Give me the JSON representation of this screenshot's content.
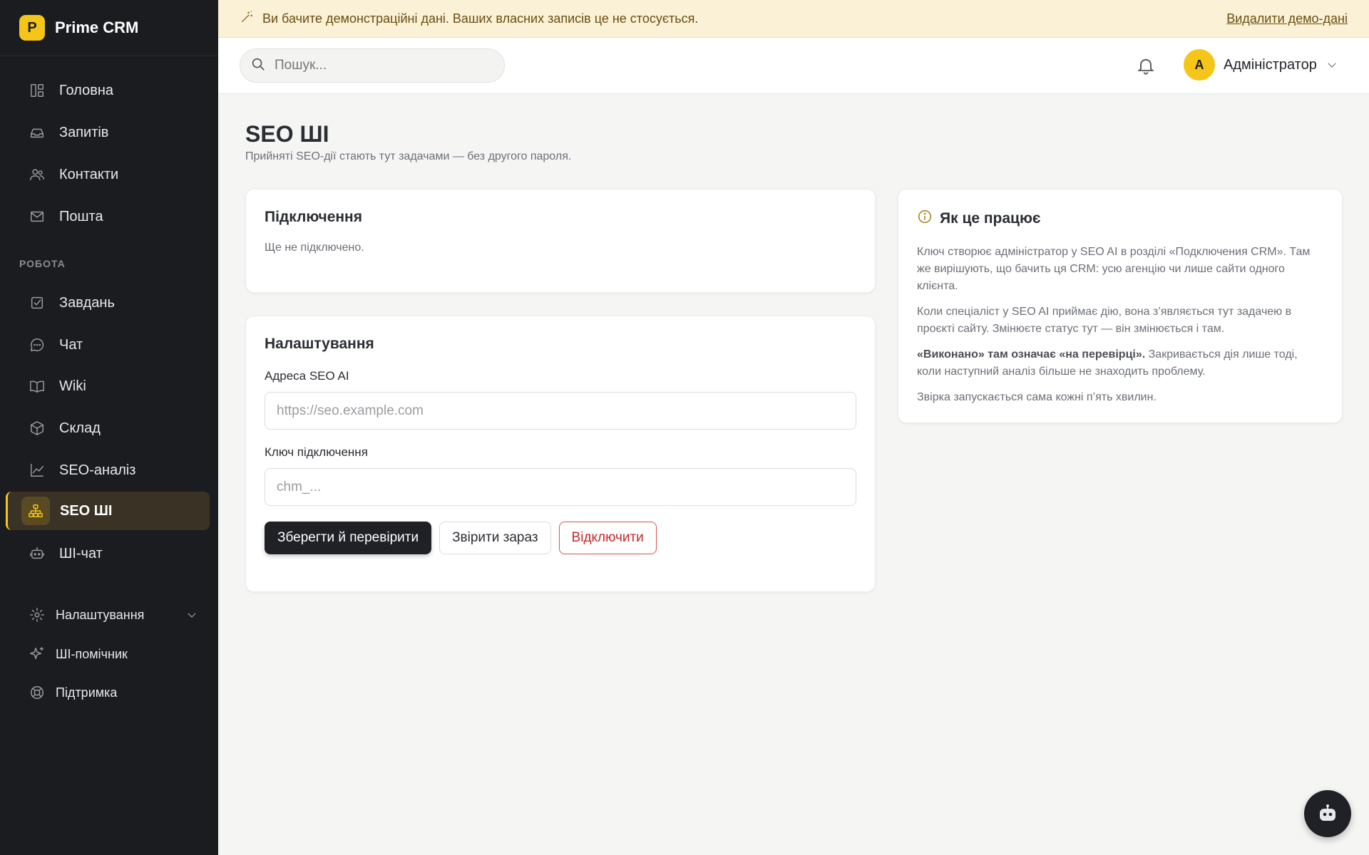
{
  "app": {
    "logo_letter": "P",
    "name": "Prime CRM"
  },
  "banner": {
    "message": "Ви бачите демонстраційні дані. Ваших власних записів це не стосується.",
    "remove_link": "Видалити демо-дані"
  },
  "header": {
    "search_placeholder": "Пошук...",
    "user_initial": "A",
    "user_name": "Адміністратор"
  },
  "sidebar": {
    "main_items": [
      {
        "label": "Головна",
        "icon": "dashboard-icon"
      },
      {
        "label": "Запитів",
        "icon": "inbox-icon"
      },
      {
        "label": "Контакти",
        "icon": "users-icon"
      },
      {
        "label": "Пошта",
        "icon": "mail-icon"
      }
    ],
    "section_label": "РОБОТА",
    "work_items": [
      {
        "label": "Завдань",
        "icon": "checkbox-icon"
      },
      {
        "label": "Чат",
        "icon": "chat-icon"
      },
      {
        "label": "Wiki",
        "icon": "book-icon"
      },
      {
        "label": "Склад",
        "icon": "box-icon"
      },
      {
        "label": "SEO-аналіз",
        "icon": "chart-icon"
      },
      {
        "label": "SEO ШІ",
        "icon": "hierarchy-icon",
        "active": true
      },
      {
        "label": "ШІ-чат",
        "icon": "robot-icon"
      }
    ],
    "bottom_items": [
      {
        "label": "Налаштування",
        "icon": "gear-icon"
      },
      {
        "label": "ШІ-помічник",
        "icon": "sparkle-icon"
      },
      {
        "label": "Підтримка",
        "icon": "lifebuoy-icon"
      }
    ]
  },
  "page": {
    "title": "SEO ШІ",
    "subtitle": "Прийняті SEO-дії стають тут задачами — без другого пароля."
  },
  "connection_card": {
    "title": "Підключення",
    "status": "Ще не підключено."
  },
  "settings_card": {
    "title": "Налаштування",
    "address_label": "Адреса SEO AI",
    "address_placeholder": "https://seo.example.com",
    "key_label": "Ключ підключення",
    "key_placeholder": "chm_...",
    "save_button": "Зберегти й перевірити",
    "check_button": "Звірити зараз",
    "disconnect_button": "Відключити"
  },
  "how_card": {
    "title": "Як це працює",
    "p1": "Ключ створює адміністратор у SEO AI в розділі «Подключения CRM». Там же вирішують, що бачить ця CRM: усю агенцію чи лише сайти одного клієнта.",
    "p2": "Коли спеціаліст у SEO AI приймає дію, вона з’являється тут задачею в проєкті сайту. Змінюєте статус тут — він змінюється і там.",
    "p3_bold": "«Виконано» там означає «на перевірці».",
    "p3_rest": " Закривається дія лише тоді, коли наступний аналіз більше не знаходить проблему.",
    "p4": "Звірка запускається сама кожні п’ять хвилин."
  },
  "colors": {
    "accent": "#f5c518",
    "sidebar_bg": "#1b1c20",
    "danger": "#c62828"
  }
}
